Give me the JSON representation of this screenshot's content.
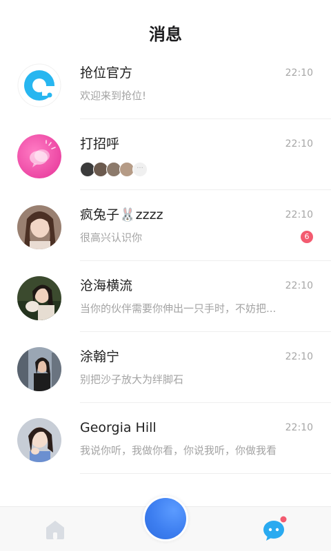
{
  "header": {
    "title": "消息"
  },
  "conversations": [
    {
      "name": "抢位官方",
      "time": "22:10",
      "preview": "欢迎来到抢位!",
      "avatar_icon": "app-logo-icon",
      "unread": null
    },
    {
      "name": "打招呼",
      "time": "22:10",
      "preview": "",
      "avatar_icon": "greeting-bubble-icon",
      "unread": null
    },
    {
      "name": "疯兔子🐰zzzz",
      "time": "22:10",
      "preview": "很高兴认识你",
      "avatar_icon": "user-avatar",
      "unread": "6"
    },
    {
      "name": "沧海横流",
      "time": "22:10",
      "preview": "当你的伙伴需要你伸出一只手时，不妨把...",
      "avatar_icon": "user-avatar",
      "unread": null
    },
    {
      "name": "涂翰宁",
      "time": "22:10",
      "preview": "别把沙子放大为绊脚石",
      "avatar_icon": "user-avatar",
      "unread": null
    },
    {
      "name": "Georgia Hill",
      "time": "22:10",
      "preview": "我说你听，我做你看，你说我听，你做我看",
      "avatar_icon": "user-avatar",
      "unread": null
    }
  ],
  "greeting_more": "···",
  "colors": {
    "accent_blue": "#3a86f5",
    "badge_red": "#f35b70",
    "pink": "#f04fa8"
  },
  "tabbar": {
    "home_icon": "home-icon",
    "center_icon": "center-action-icon",
    "message_icon": "message-bubble-icon"
  }
}
